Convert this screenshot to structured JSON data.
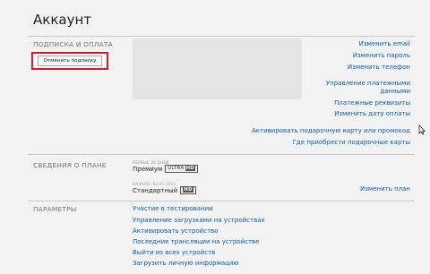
{
  "header": {
    "title": "Аккаунт"
  },
  "subscription": {
    "section_title": "ПОДПИСКА И ОПЛАТА",
    "cancel_button": "Отменить подписку",
    "links": [
      "Изменить email",
      "Изменить пароль",
      "Изменить телефон",
      "Управление платежными",
      "данными",
      "Платежные реквизиты",
      "Изменить дату оплаты",
      "Активировать подарочную карту или промокод",
      "Где приобрести подарочные карты"
    ]
  },
  "plan": {
    "section_title": "СВЕДЕНИЯ О ПЛАНЕ",
    "current_label": "ПЕРВЫЕ 30 ДНЕЙ",
    "current_name": "Премиум",
    "current_badge": "ULTRA",
    "current_badge_hd": "HD",
    "next_label": "НАЧАЛО: 03.01.2021",
    "next_name": "Стандартный",
    "next_badge": "HD",
    "change_link": "Изменить план"
  },
  "settings": {
    "section_title": "ПАРАМЕТРЫ",
    "links": [
      "Участие в тестировании",
      "Управление загрузками на устройствах",
      "Активировать устройство",
      "Последние трансляции на устройстве",
      "Выйти из всех устройств",
      "Загрузить личную информацию"
    ]
  },
  "colors": {
    "accent_red": "#d11a2a",
    "link_blue": "#0b5bb5"
  }
}
